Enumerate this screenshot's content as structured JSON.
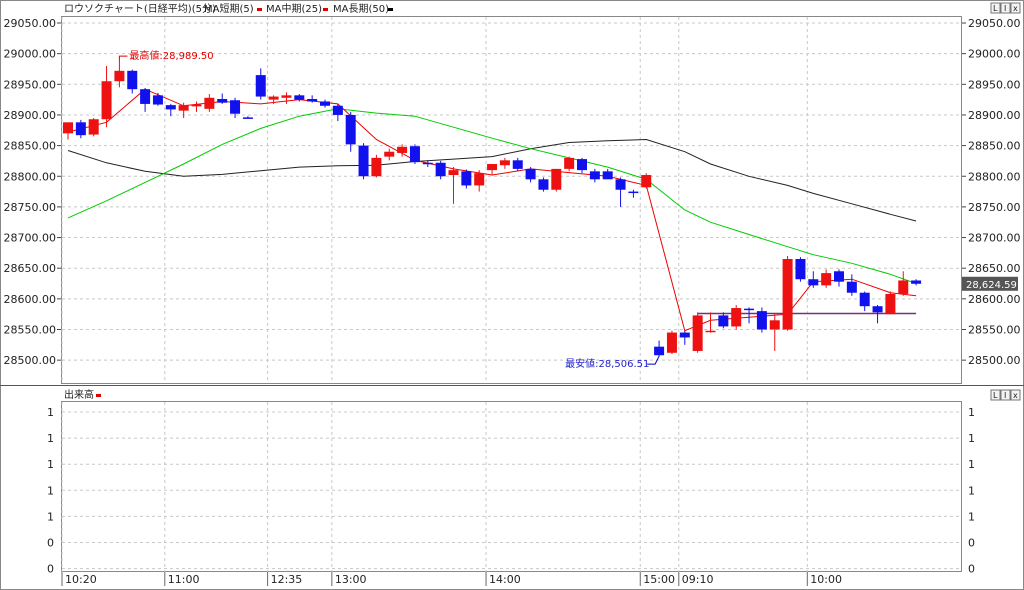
{
  "header": {
    "chart_title": "ロウソクチャート(日経平均)(5分)",
    "ma_short_label": "MA短期(5)",
    "ma_mid_label": "MA中期(25)",
    "ma_long_label": "MA長期(50)",
    "ma_short_color": "#e00000",
    "ma_mid_color": "#e00000",
    "ma_long_color": "#000000",
    "volume_title": "出来高",
    "volume_color": "#e00000"
  },
  "window_buttons": [
    "L",
    "I",
    "x"
  ],
  "colors": {
    "up": "#ee1111",
    "down": "#1111ee",
    "ma5": "#ee0000",
    "ma25": "#00cc00",
    "ma50": "#222222",
    "price_tag_bg": "#555555",
    "line_marker": "#7b2c7b"
  },
  "annotations": {
    "high_label": "最高値:28,989.50",
    "low_label": "最安値:28,506.51",
    "current_price": "28,624.59"
  },
  "chart_data": {
    "type": "candlestick",
    "title": "ロウソクチャート(日経平均)(5分)",
    "ylim": [
      28450,
      29080
    ],
    "y_ticks": [
      "29050.00",
      "29000.00",
      "28950.00",
      "28900.00",
      "28850.00",
      "28800.00",
      "28750.00",
      "28700.00",
      "28650.00",
      "28600.00",
      "28550.00",
      "28500.00"
    ],
    "y_tick_values": [
      29050,
      29000,
      28950,
      28900,
      28850,
      28800,
      28750,
      28700,
      28650,
      28600,
      28550,
      28500
    ],
    "x_tick_labels": [
      {
        "index": 0,
        "label": "10:20"
      },
      {
        "index": 8,
        "label": "11:00"
      },
      {
        "index": 16,
        "label": "12:35"
      },
      {
        "index": 21,
        "label": "13:00"
      },
      {
        "index": 33,
        "label": "14:00"
      },
      {
        "index": 45,
        "label": "15:00"
      },
      {
        "index": 48,
        "label": "09:10"
      },
      {
        "index": 58,
        "label": "10:00"
      }
    ],
    "candles": [
      {
        "o": 28870,
        "h": 28885,
        "l": 28860,
        "c": 28888
      },
      {
        "o": 28888,
        "h": 28892,
        "l": 28862,
        "c": 28867
      },
      {
        "o": 28868,
        "h": 28895,
        "l": 28865,
        "c": 28893
      },
      {
        "o": 28893,
        "h": 28980,
        "l": 28880,
        "c": 28955
      },
      {
        "o": 28955,
        "h": 28990,
        "l": 28945,
        "c": 28972
      },
      {
        "o": 28972,
        "h": 28974,
        "l": 28935,
        "c": 28942
      },
      {
        "o": 28942,
        "h": 28944,
        "l": 28905,
        "c": 28918
      },
      {
        "o": 28932,
        "h": 28936,
        "l": 28915,
        "c": 28917
      },
      {
        "o": 28916,
        "h": 28918,
        "l": 28898,
        "c": 28909
      },
      {
        "o": 28907,
        "h": 28920,
        "l": 28895,
        "c": 28916
      },
      {
        "o": 28914,
        "h": 28922,
        "l": 28905,
        "c": 28917
      },
      {
        "o": 28910,
        "h": 28934,
        "l": 28905,
        "c": 28928
      },
      {
        "o": 28926,
        "h": 28935,
        "l": 28918,
        "c": 28920
      },
      {
        "o": 28924,
        "h": 28928,
        "l": 28895,
        "c": 28902
      },
      {
        "o": 28896,
        "h": 28898,
        "l": 28894,
        "c": 28895
      },
      {
        "o": 28965,
        "h": 28976,
        "l": 28925,
        "c": 28930
      },
      {
        "o": 28925,
        "h": 28932,
        "l": 28918,
        "c": 28930
      },
      {
        "o": 28928,
        "h": 28937,
        "l": 28918,
        "c": 28932
      },
      {
        "o": 28932,
        "h": 28934,
        "l": 28922,
        "c": 28925
      },
      {
        "o": 28926,
        "h": 28932,
        "l": 28920,
        "c": 28922
      },
      {
        "o": 28922,
        "h": 28925,
        "l": 28912,
        "c": 28915
      },
      {
        "o": 28915,
        "h": 28918,
        "l": 28890,
        "c": 28900
      },
      {
        "o": 28900,
        "h": 28905,
        "l": 28840,
        "c": 28852
      },
      {
        "o": 28850,
        "h": 28854,
        "l": 28795,
        "c": 28800
      },
      {
        "o": 28800,
        "h": 28835,
        "l": 28798,
        "c": 28830
      },
      {
        "o": 28832,
        "h": 28845,
        "l": 28826,
        "c": 28840
      },
      {
        "o": 28838,
        "h": 28852,
        "l": 28832,
        "c": 28848
      },
      {
        "o": 28849,
        "h": 28852,
        "l": 28820,
        "c": 28823
      },
      {
        "o": 28822,
        "h": 28826,
        "l": 28815,
        "c": 28820
      },
      {
        "o": 28822,
        "h": 28825,
        "l": 28795,
        "c": 28800
      },
      {
        "o": 28802,
        "h": 28815,
        "l": 28755,
        "c": 28810
      },
      {
        "o": 28808,
        "h": 28811,
        "l": 28780,
        "c": 28785
      },
      {
        "o": 28785,
        "h": 28810,
        "l": 28775,
        "c": 28805
      },
      {
        "o": 28810,
        "h": 28820,
        "l": 28802,
        "c": 28820
      },
      {
        "o": 28818,
        "h": 28830,
        "l": 28812,
        "c": 28826
      },
      {
        "o": 28826,
        "h": 28830,
        "l": 28808,
        "c": 28812
      },
      {
        "o": 28812,
        "h": 28815,
        "l": 28790,
        "c": 28795
      },
      {
        "o": 28795,
        "h": 28798,
        "l": 28775,
        "c": 28778
      },
      {
        "o": 28778,
        "h": 28812,
        "l": 28775,
        "c": 28812
      },
      {
        "o": 28812,
        "h": 28832,
        "l": 28808,
        "c": 28830
      },
      {
        "o": 28828,
        "h": 28830,
        "l": 28805,
        "c": 28810
      },
      {
        "o": 28808,
        "h": 28812,
        "l": 28790,
        "c": 28795
      },
      {
        "o": 28808,
        "h": 28812,
        "l": 28798,
        "c": 28795
      },
      {
        "o": 28795,
        "h": 28798,
        "l": 28750,
        "c": 28778
      },
      {
        "o": 28775,
        "h": 28778,
        "l": 28765,
        "c": 28773
      },
      {
        "o": 28782,
        "h": 28805,
        "l": 28780,
        "c": 28802
      },
      {
        "o": 28522,
        "h": 28532,
        "l": 28506,
        "c": 28508
      },
      {
        "o": 28512,
        "h": 28548,
        "l": 28510,
        "c": 28545
      },
      {
        "o": 28545,
        "h": 28548,
        "l": 28525,
        "c": 28537
      },
      {
        "o": 28515,
        "h": 28578,
        "l": 28512,
        "c": 28573
      },
      {
        "o": 28548,
        "h": 28578,
        "l": 28545,
        "c": 28548
      },
      {
        "o": 28573,
        "h": 28578,
        "l": 28552,
        "c": 28555
      },
      {
        "o": 28555,
        "h": 28590,
        "l": 28550,
        "c": 28585
      },
      {
        "o": 28584,
        "h": 28586,
        "l": 28560,
        "c": 28582
      },
      {
        "o": 28580,
        "h": 28586,
        "l": 28545,
        "c": 28550
      },
      {
        "o": 28550,
        "h": 28575,
        "l": 28515,
        "c": 28565
      },
      {
        "o": 28550,
        "h": 28670,
        "l": 28548,
        "c": 28665
      },
      {
        "o": 28665,
        "h": 28668,
        "l": 28628,
        "c": 28632
      },
      {
        "o": 28632,
        "h": 28645,
        "l": 28618,
        "c": 28622
      },
      {
        "o": 28622,
        "h": 28648,
        "l": 28618,
        "c": 28642
      },
      {
        "o": 28645,
        "h": 28648,
        "l": 28620,
        "c": 28628
      },
      {
        "o": 28628,
        "h": 28640,
        "l": 28605,
        "c": 28610
      },
      {
        "o": 28610,
        "h": 28612,
        "l": 28580,
        "c": 28588
      },
      {
        "o": 28588,
        "h": 28590,
        "l": 28560,
        "c": 28578
      },
      {
        "o": 28575,
        "h": 28612,
        "l": 28575,
        "c": 28608
      },
      {
        "o": 28608,
        "h": 28645,
        "l": 28605,
        "c": 28630
      },
      {
        "o": 28630,
        "h": 28632,
        "l": 28622,
        "c": 28624.59
      }
    ],
    "ma5": [
      [
        0,
        28872
      ],
      [
        3,
        28888
      ],
      [
        6,
        28942
      ],
      [
        9,
        28915
      ],
      [
        12,
        28922
      ],
      [
        15,
        28918
      ],
      [
        18,
        28925
      ],
      [
        21,
        28918
      ],
      [
        24,
        28860
      ],
      [
        27,
        28826
      ],
      [
        30,
        28812
      ],
      [
        33,
        28802
      ],
      [
        36,
        28812
      ],
      [
        39,
        28806
      ],
      [
        42,
        28800
      ],
      [
        45,
        28785
      ],
      [
        48,
        28548
      ],
      [
        50,
        28565
      ],
      [
        53,
        28570
      ],
      [
        56,
        28575
      ],
      [
        58,
        28628
      ],
      [
        61,
        28632
      ],
      [
        64,
        28610
      ],
      [
        66,
        28605
      ]
    ],
    "ma25": [
      [
        0,
        28732
      ],
      [
        3,
        28760
      ],
      [
        6,
        28790
      ],
      [
        9,
        28820
      ],
      [
        12,
        28852
      ],
      [
        15,
        28878
      ],
      [
        18,
        28898
      ],
      [
        21,
        28910
      ],
      [
        24,
        28903
      ],
      [
        27,
        28898
      ],
      [
        30,
        28880
      ],
      [
        33,
        28862
      ],
      [
        36,
        28845
      ],
      [
        39,
        28830
      ],
      [
        42,
        28815
      ],
      [
        45,
        28795
      ],
      [
        48,
        28745
      ],
      [
        50,
        28725
      ],
      [
        53,
        28705
      ],
      [
        56,
        28685
      ],
      [
        58,
        28672
      ],
      [
        61,
        28658
      ],
      [
        64,
        28640
      ],
      [
        66,
        28625
      ]
    ],
    "ma50": [
      [
        0,
        28842
      ],
      [
        3,
        28822
      ],
      [
        6,
        28808
      ],
      [
        9,
        28800
      ],
      [
        12,
        28803
      ],
      [
        15,
        28809
      ],
      [
        18,
        28815
      ],
      [
        21,
        28817
      ],
      [
        24,
        28818
      ],
      [
        27,
        28824
      ],
      [
        30,
        28828
      ],
      [
        33,
        28832
      ],
      [
        36,
        28845
      ],
      [
        39,
        28855
      ],
      [
        42,
        28858
      ],
      [
        45,
        28860
      ],
      [
        48,
        28840
      ],
      [
        50,
        28820
      ],
      [
        53,
        28800
      ],
      [
        56,
        28785
      ],
      [
        58,
        28772
      ],
      [
        61,
        28755
      ],
      [
        64,
        28738
      ],
      [
        66,
        28727
      ]
    ],
    "horizontal_level": {
      "value": 28576,
      "from_index": 49,
      "to_index": 66
    },
    "high": {
      "index": 4,
      "value": 28989.5
    },
    "low": {
      "index": 46,
      "value": 28506.51
    },
    "volume_panel": {
      "title": "出来高",
      "y_ticks": [
        "1",
        "1",
        "1",
        "1",
        "1",
        "0",
        "0",
        "0"
      ]
    }
  }
}
